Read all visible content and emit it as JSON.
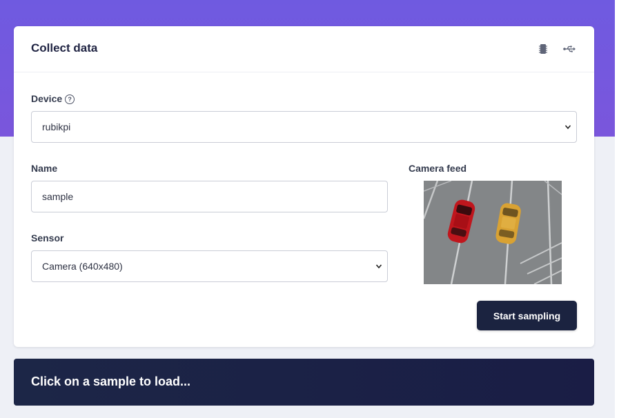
{
  "card": {
    "title": "Collect data",
    "icons": [
      "chip-icon",
      "usb-icon"
    ]
  },
  "device": {
    "label": "Device",
    "value": "rubikpi"
  },
  "name": {
    "label": "Name",
    "value": "sample"
  },
  "sensor": {
    "label": "Sensor",
    "value": "Camera (640x480)"
  },
  "camera": {
    "label": "Camera feed"
  },
  "actions": {
    "start_label": "Start sampling"
  },
  "bottom": {
    "message": "Click on a sample to load..."
  },
  "colors": {
    "header_gradient": "#6f5ae0",
    "button_bg": "#1b2340",
    "panel_bg": "#1c2647"
  }
}
